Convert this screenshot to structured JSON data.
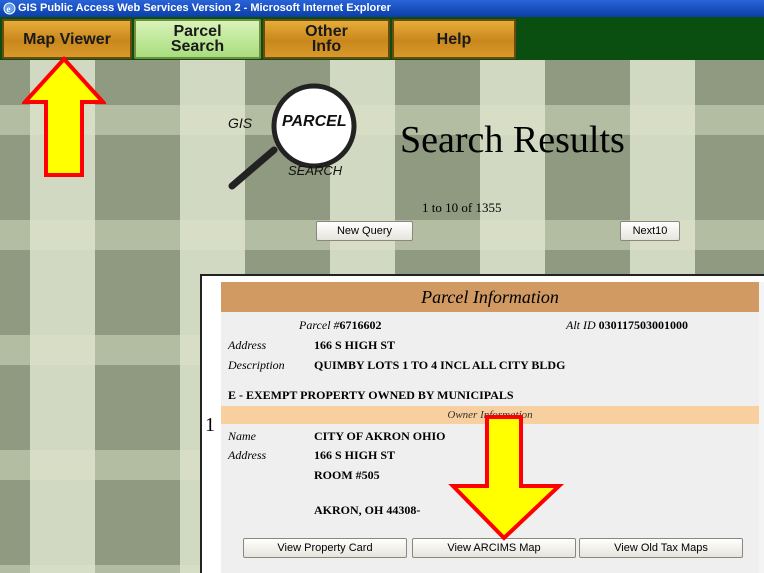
{
  "window": {
    "title": "GIS Public Access Web Services Version 2 - Microsoft Internet Explorer"
  },
  "nav": {
    "map_viewer": "Map Viewer",
    "parcel_search_1": "Parcel",
    "parcel_search_2": "Search",
    "other_info_1": "Other",
    "other_info_2": "Info",
    "help": "Help"
  },
  "logo": {
    "gis": "GIS",
    "parcel": "PARCEL",
    "search": "SEARCH"
  },
  "page": {
    "heading": "Search Results",
    "range": "1 to 10 of 1355"
  },
  "buttons": {
    "new_query": "New Query",
    "next10": "Next10"
  },
  "result": {
    "row_number": "1",
    "header": "Parcel Information",
    "parcel_label": "Parcel #",
    "parcel_value": "6716602",
    "alt_id_label": "Alt ID",
    "alt_id_value": "030117503001000",
    "address_label": "Address",
    "address_value": "166 S HIGH ST",
    "description_label": "Description",
    "description_value": "QUIMBY LOTS 1 TO 4 INCL ALL CITY BLDG",
    "class_line": "E - EXEMPT PROPERTY OWNED BY MUNICIPALS",
    "owner_header": "Owner Information",
    "name_label": "Name",
    "name_value": "CITY OF AKRON OHIO",
    "owner_address_label": "Address",
    "owner_address_1": "166 S HIGH ST",
    "owner_address_2": "ROOM #505",
    "owner_address_3": "AKRON, OH 44308-",
    "view_property_card": "View Property Card",
    "view_arcims_map": "View ARCIMS Map",
    "view_old_tax_maps": "View Old Tax Maps"
  },
  "colors": {
    "arrow_fill": "#ffff00",
    "arrow_stroke": "#ff0000"
  }
}
